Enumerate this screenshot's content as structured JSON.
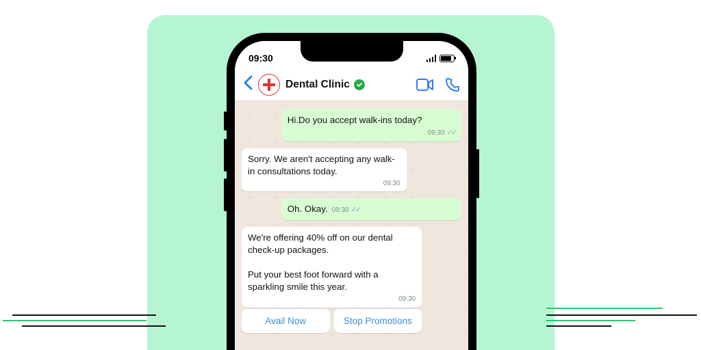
{
  "status": {
    "time": "09:30"
  },
  "header": {
    "title": "Dental Clinic"
  },
  "messages": {
    "m1": {
      "text": "Hi.Do you accept walk-ins today?",
      "time": "09:30"
    },
    "m2": {
      "text": "Sorry. We aren't accepting any walk-in consultations today.",
      "time": "09:30"
    },
    "m3": {
      "text": "Oh. Okay.",
      "time": "09:30"
    },
    "m4": {
      "text": "We're offering 40% off on our dental check-up packages.\n\nPut your best foot forward with a sparkling smile this year.",
      "time": "09:30"
    }
  },
  "buttons": {
    "avail": "Avail Now",
    "stop": "Stop Promotions"
  }
}
